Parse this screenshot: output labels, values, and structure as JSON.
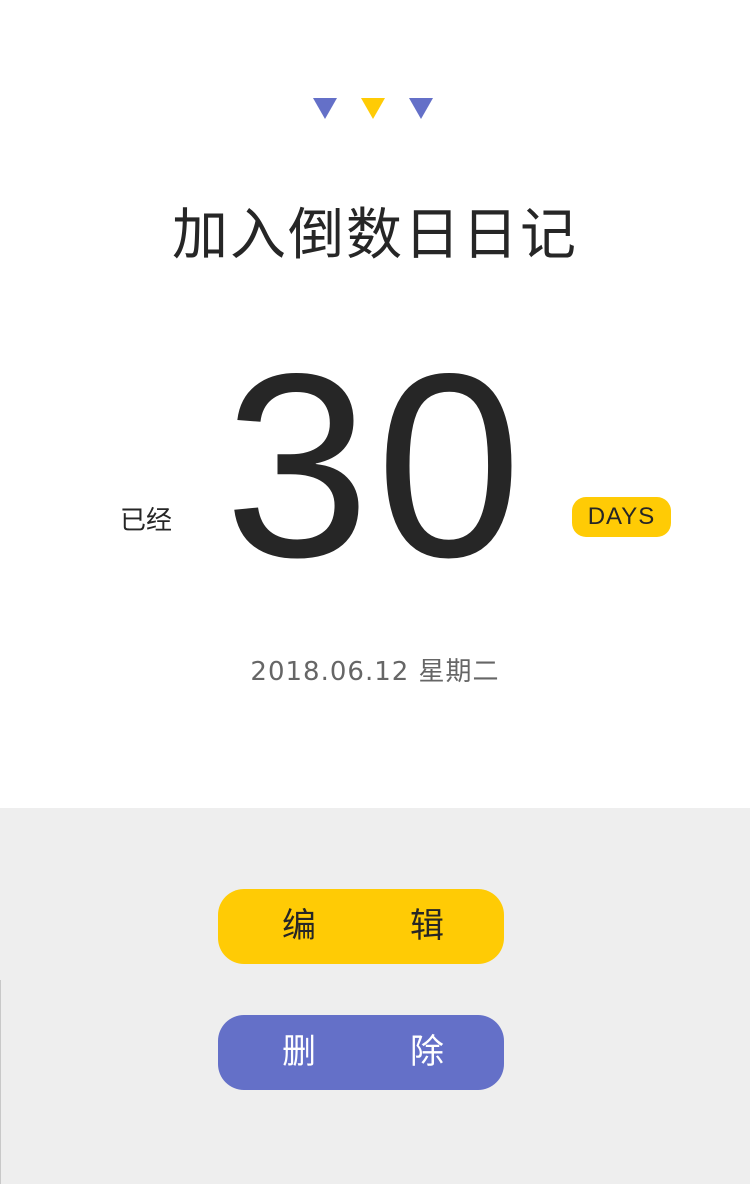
{
  "header": {
    "title": "加入倒数日日记"
  },
  "counter": {
    "prefix": "已经",
    "value": "30",
    "unit": "DAYS"
  },
  "date_text": "2018.06.12  星期二",
  "actions": {
    "edit": [
      "编",
      "辑"
    ],
    "delete": [
      "删",
      "除"
    ]
  },
  "colors": {
    "accent_yellow": "#ffcb05",
    "accent_purple": "#6470c8",
    "text_dark": "#262626",
    "text_gray": "#666666",
    "bottom_bg": "#eeeeee"
  }
}
